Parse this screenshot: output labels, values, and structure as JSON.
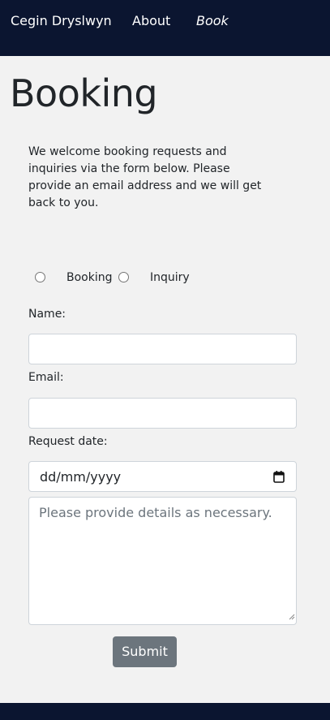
{
  "nav": {
    "brand": "Cegin Dryslwyn",
    "about": "About",
    "book": "Book"
  },
  "page": {
    "title": "Booking",
    "intro": "We welcome booking requests and inquiries via the form below. Please provide an email address and we will get back to you."
  },
  "form": {
    "radio_booking_label": "Booking",
    "radio_inquiry_label": "Inquiry",
    "name_label": "Name:",
    "name_value": "",
    "email_label": "Email:",
    "email_value": "",
    "date_label": "Request date:",
    "date_placeholder": "dd/mm/yyyy",
    "details_placeholder": "Please provide details as necessary.",
    "submit_label": "Submit"
  },
  "colors": {
    "navbar_bg": "#0b1530",
    "page_bg": "#f2f2f2",
    "submit_bg": "#6c757d"
  },
  "icons": {
    "date_picker": "calendar-icon"
  }
}
